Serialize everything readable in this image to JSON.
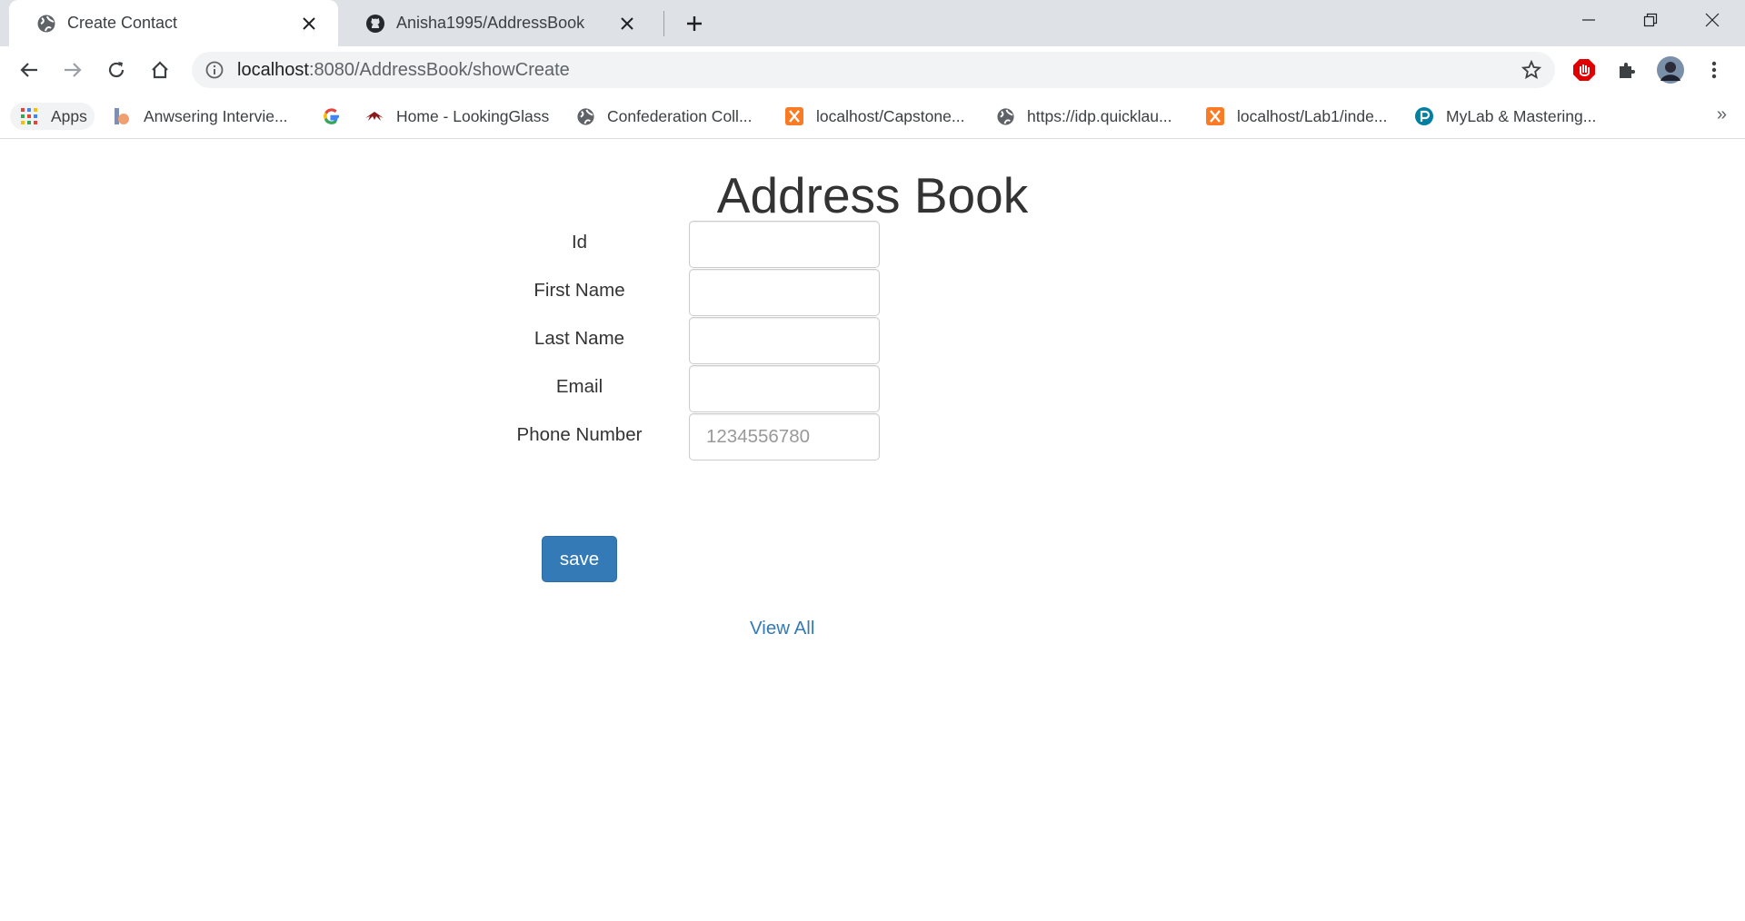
{
  "browser": {
    "tabs": [
      {
        "title": "Create Contact",
        "icon": "globe-icon",
        "active": true
      },
      {
        "title": "Anisha1995/AddressBook",
        "icon": "github-icon",
        "active": false
      }
    ],
    "address_bar": {
      "host": "localhost",
      "path": ":8080/AddressBook/showCreate"
    },
    "bookmarks": [
      {
        "label": "Apps",
        "icon": "apps-grid-icon"
      },
      {
        "label": "Anwsering Intervie...",
        "icon": "bookmark-site-icon"
      },
      {
        "label": "",
        "icon": "google-icon"
      },
      {
        "label": "Home - LookingGlass",
        "icon": "lookingglass-icon"
      },
      {
        "label": "Confederation Coll...",
        "icon": "globe-icon"
      },
      {
        "label": "localhost/Capstone...",
        "icon": "xampp-icon"
      },
      {
        "label": "https://idp.quicklau...",
        "icon": "globe-icon"
      },
      {
        "label": "localhost/Lab1/inde...",
        "icon": "xampp-icon"
      },
      {
        "label": "MyLab & Mastering...",
        "icon": "pearson-icon"
      }
    ],
    "bookmarks_overflow": "»"
  },
  "page": {
    "heading": "Address Book",
    "form": {
      "fields": [
        {
          "label": "Id",
          "value": "",
          "placeholder": ""
        },
        {
          "label": "First Name",
          "value": "",
          "placeholder": ""
        },
        {
          "label": "Last Name",
          "value": "",
          "placeholder": ""
        },
        {
          "label": "Email",
          "value": "",
          "placeholder": ""
        },
        {
          "label": "Phone Number",
          "value": "",
          "placeholder": "1234556780"
        }
      ],
      "submit_label": "save"
    },
    "view_all_label": "View All"
  },
  "colors": {
    "primary": "#337ab7",
    "tabstrip": "#dee1e6",
    "omnibox": "#f1f3f4"
  }
}
